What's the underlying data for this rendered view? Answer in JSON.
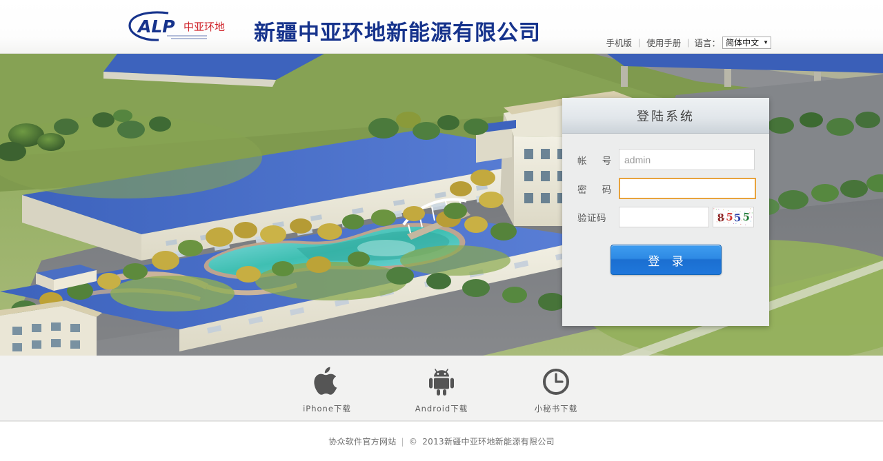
{
  "header": {
    "logo_alt_text": "ALP",
    "logo_cn_text": "中亚环地",
    "company_title": "新疆中亚环地新能源有限公司",
    "nav": {
      "mobile_label": "手机版",
      "manual_label": "使用手册",
      "language_label": "语言：",
      "language_value": "简体中文",
      "separator": "|"
    }
  },
  "login": {
    "panel_title": "登陆系统",
    "account_label": "帐 号",
    "account_value": "admin",
    "password_label": "密 码",
    "password_value": "",
    "captcha_label": "验证码",
    "captcha_value": "",
    "captcha_code": "8555",
    "captcha_digits": [
      {
        "char": "8",
        "color": "#8a1f1f"
      },
      {
        "char": "5",
        "color": "#d0302a"
      },
      {
        "char": "5",
        "color": "#2b3fa8"
      },
      {
        "char": "5",
        "color": "#1d7a36"
      }
    ],
    "submit_label": "登 录"
  },
  "downloads": [
    {
      "icon": "apple-icon",
      "label": "iPhone下载"
    },
    {
      "icon": "android-icon",
      "label": "Android下载"
    },
    {
      "icon": "clock-icon",
      "label": "小秘书下载"
    }
  ],
  "footer": {
    "site_link": "协众软件官方网站",
    "separator": "|",
    "copyright_symbol": "©",
    "copyright": "2013新疆中亚环地新能源有限公司"
  },
  "colors": {
    "brand_blue": "#16338c",
    "brand_red": "#cf2128",
    "button_blue": "#2e8ae4",
    "focus_orange": "#e8a33d",
    "panel_bg": "#eceded",
    "strip_bg": "#f2f2f1"
  }
}
